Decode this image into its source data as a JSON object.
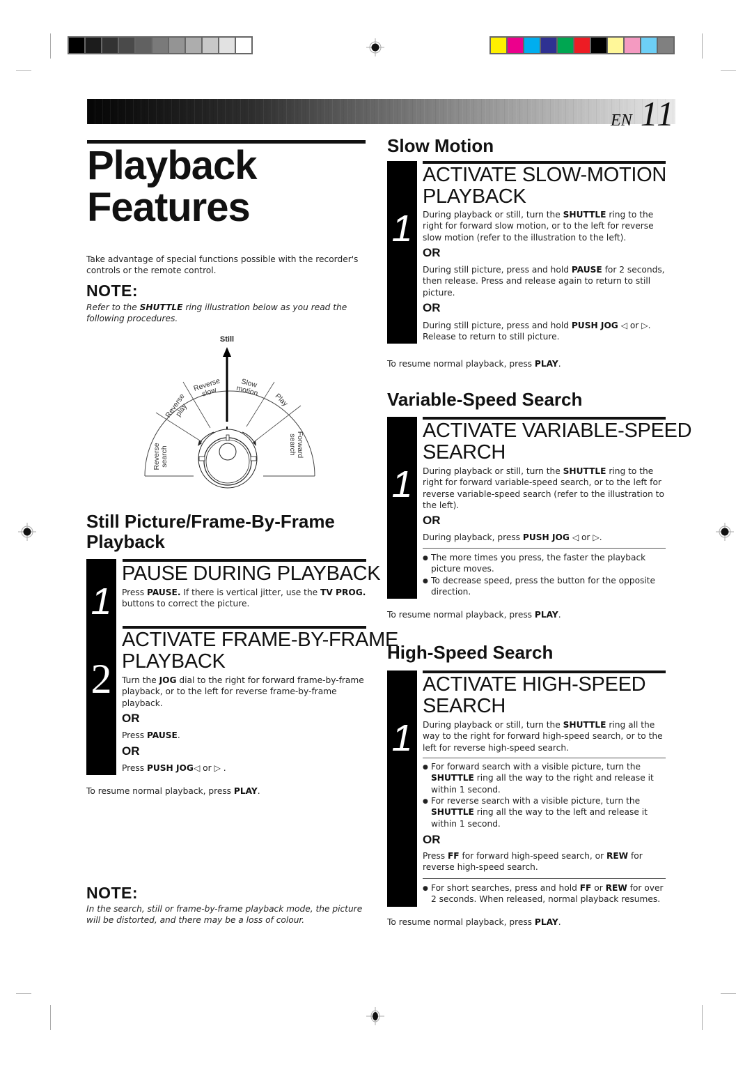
{
  "page": {
    "lang": "EN",
    "number": "11",
    "title_line1": "Playback",
    "title_line2": "Features"
  },
  "colors": {
    "gray_swatches": [
      "#000000",
      "#1c1c1c",
      "#333333",
      "#4a4a4a",
      "#616161",
      "#7a7a7a",
      "#949494",
      "#adadad",
      "#c8c8c8",
      "#e2e2e2",
      "#ffffff"
    ],
    "color_swatches": [
      "#fff000",
      "#ec008c",
      "#00aeef",
      "#2e3192",
      "#00a651",
      "#ed1c24",
      "#000000",
      "#fff799",
      "#f49ac1",
      "#6dcff6",
      "#808080"
    ]
  },
  "intro": "Take advantage of special functions possible with the recorder's controls or the remote control.",
  "note1": {
    "heading": "NOTE:",
    "pre": "Refer to the ",
    "bold": "SHUTTLE",
    "post": " ring illustration below as you read the following procedures."
  },
  "diagram": {
    "still": "Still",
    "reverse_search_1": "Reverse",
    "reverse_search_2": "search",
    "reverse_play_1": "Reverse",
    "reverse_play_2": "play",
    "reverse_slow_1": "Reverse",
    "reverse_slow_2": "slow",
    "slow_motion_1": "Slow",
    "slow_motion_2": "motion",
    "play": "Play",
    "forward_search_1": "Forward",
    "forward_search_2": "search"
  },
  "still_section": {
    "heading_line1": "Still Picture/Frame-By-Frame",
    "heading_line2": "Playback",
    "step1": {
      "number": "1",
      "title": "PAUSE DURING PLAYBACK",
      "t1": "Press ",
      "b1": "PAUSE.",
      "t2": " If there is vertical jitter, use the ",
      "b2": "TV PROG.",
      "t3": "buttons to correct the picture."
    },
    "step2": {
      "number": "2",
      "title_line1": "ACTIVATE FRAME-BY-FRAME",
      "title_line2": "PLAYBACK",
      "t1": "Turn the ",
      "b1": "JOG",
      "t2": " dial to the right for forward frame-by-frame playback, or to the left for reverse frame-by-frame playback.",
      "or1": "OR",
      "alt1_pre": "Press ",
      "alt1_bold": "PAUSE",
      "alt1_post": ".",
      "or2": "OR",
      "alt2_pre": "Press ",
      "alt2_bold": "PUSH JOG",
      "alt2_post": "◁ or ▷ ."
    },
    "resume_pre": "To resume normal playback, press ",
    "resume_bold": "PLAY",
    "resume_post": "."
  },
  "note2": {
    "heading": "NOTE:",
    "text": "In the search, still or frame-by-frame playback mode, the picture will be distorted, and there may be a loss of colour."
  },
  "slow_motion": {
    "heading": "Slow Motion",
    "number": "1",
    "title_line1": "ACTIVATE SLOW-MOTION",
    "title_line2": "PLAYBACK",
    "t1": "During playback or still, turn the ",
    "b1": "SHUTTLE",
    "t2": " ring to the right for forward slow motion, or to the left for reverse slow motion (refer to the illustration to the left).",
    "or1": "OR",
    "a1_pre": "During still picture, press and hold ",
    "a1_bold": "PAUSE",
    "a1_post": "  for 2 seconds, then release. Press and release again to return to still picture.",
    "or2": "OR",
    "a2_pre": "During still picture, press and hold ",
    "a2_bold": "PUSH JOG",
    "a2_post": " ◁ or ▷. Release to return to still picture.",
    "resume_pre": "To resume normal playback, press ",
    "resume_bold": "PLAY",
    "resume_post": "."
  },
  "variable_speed": {
    "heading": "Variable-Speed Search",
    "number": "1",
    "title_line1": "ACTIVATE VARIABLE-SPEED",
    "title_line2": "SEARCH",
    "t1": "During playback or still, turn the ",
    "b1": "SHUTTLE",
    "t2": " ring to the right for forward variable-speed search, or to the left for reverse variable-speed search (refer to the illustration to the left).",
    "or1": "OR",
    "a1_pre": "During playback, press ",
    "a1_bold": "PUSH JOG",
    "a1_post": " ◁ or ▷.",
    "bullets": [
      "The more times you press, the faster the playback picture moves.",
      "To decrease speed, press the button for the opposite direction."
    ],
    "resume_pre": "To resume normal playback, press ",
    "resume_bold": "PLAY",
    "resume_post": "."
  },
  "high_speed": {
    "heading": "High-Speed Search",
    "number": "1",
    "title_line1": "ACTIVATE HIGH-SPEED",
    "title_line2": "SEARCH",
    "t1": "During playback or still, turn the ",
    "b1": "SHUTTLE",
    "t2": " ring all the way to the right for forward high-speed search, or to the left for reverse high-speed search.",
    "bullet1_pre": "For forward search with a visible picture, turn the ",
    "bullet1_bold": "SHUTTLE",
    "bullet1_post": " ring all the way to the right and release it within 1 second.",
    "bullet2_pre": "For reverse search with a visible picture, turn the ",
    "bullet2_bold": "SHUTTLE",
    "bullet2_post": " ring all the way to the left and release it within 1 second.",
    "or1": "OR",
    "a1_pre": "Press ",
    "a1_b1": "FF",
    "a1_mid": " for forward high-speed search, or ",
    "a1_b2": "REW",
    "a1_post": " for reverse high-speed search.",
    "bullet3_pre": "For short searches, press and hold ",
    "bullet3_b1": "FF",
    "bullet3_mid": " or ",
    "bullet3_b2": "REW",
    "bullet3_post": " for over 2 seconds. When released, normal playback resumes.",
    "resume_pre": "To resume normal playback, press ",
    "resume_bold": "PLAY",
    "resume_post": "."
  }
}
